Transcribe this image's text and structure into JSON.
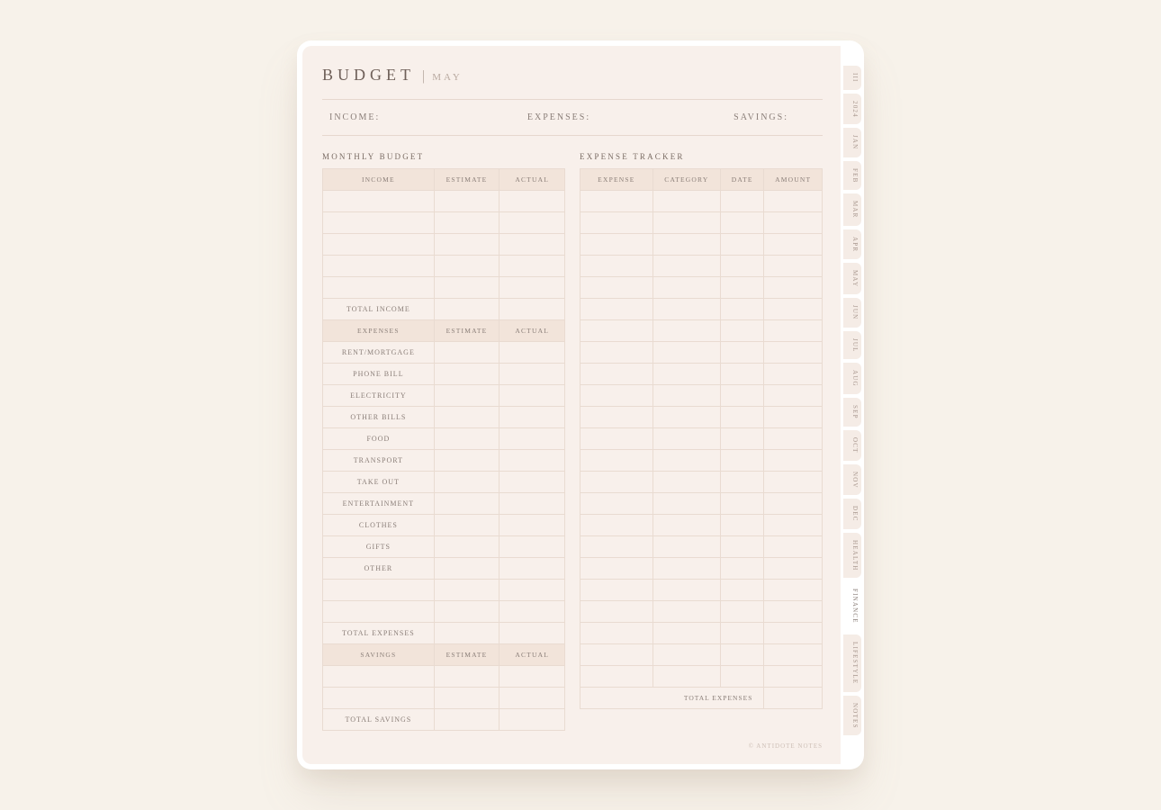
{
  "title": {
    "budget": "BUDGET",
    "pipe": "|",
    "month": "MAY"
  },
  "summary": {
    "income": "INCOME:",
    "expenses": "EXPENSES:",
    "savings": "SAVINGS:"
  },
  "sections": {
    "monthly": "MONTHLY BUDGET",
    "tracker": "EXPENSE TRACKER"
  },
  "budget": {
    "income_header": {
      "label": "INCOME",
      "estimate": "ESTIMATE",
      "actual": "ACTUAL"
    },
    "income_rows": [
      "",
      "",
      "",
      "",
      ""
    ],
    "total_income": "TOTAL INCOME",
    "expenses_header": {
      "label": "EXPENSES",
      "estimate": "ESTIMATE",
      "actual": "ACTUAL"
    },
    "expense_rows": [
      "RENT/MORTGAGE",
      "PHONE BILL",
      "ELECTRICITY",
      "OTHER BILLS",
      "FOOD",
      "TRANSPORT",
      "TAKE OUT",
      "ENTERTAINMENT",
      "CLOTHES",
      "GIFTS",
      "OTHER",
      "",
      ""
    ],
    "total_expenses": "TOTAL EXPENSES",
    "savings_header": {
      "label": "SAVINGS",
      "estimate": "ESTIMATE",
      "actual": "ACTUAL"
    },
    "savings_rows": [
      "",
      ""
    ],
    "total_savings": "TOTAL SAVINGS"
  },
  "tracker": {
    "header": {
      "expense": "EXPENSE",
      "category": "CATEGORY",
      "date": "DATE",
      "amount": "AMOUNT"
    },
    "rows": 23,
    "total": "TOTAL EXPENSES"
  },
  "tabs": [
    {
      "label": "III",
      "active": false
    },
    {
      "label": "2024",
      "active": false
    },
    {
      "label": "JAN",
      "active": false
    },
    {
      "label": "FEB",
      "active": false
    },
    {
      "label": "MAR",
      "active": false
    },
    {
      "label": "APR",
      "active": false
    },
    {
      "label": "MAY",
      "active": false
    },
    {
      "label": "JUN",
      "active": false
    },
    {
      "label": "JUL",
      "active": false
    },
    {
      "label": "AUG",
      "active": false
    },
    {
      "label": "SEP",
      "active": false
    },
    {
      "label": "OCT",
      "active": false
    },
    {
      "label": "NOV",
      "active": false
    },
    {
      "label": "DEC",
      "active": false
    },
    {
      "label": "HEALTH",
      "active": false
    },
    {
      "label": "FINANCE",
      "active": true
    },
    {
      "label": "LIFESTYLE",
      "active": false
    },
    {
      "label": "NOTES",
      "active": false
    }
  ],
  "credit": "© ANTIDOTE NOTES"
}
